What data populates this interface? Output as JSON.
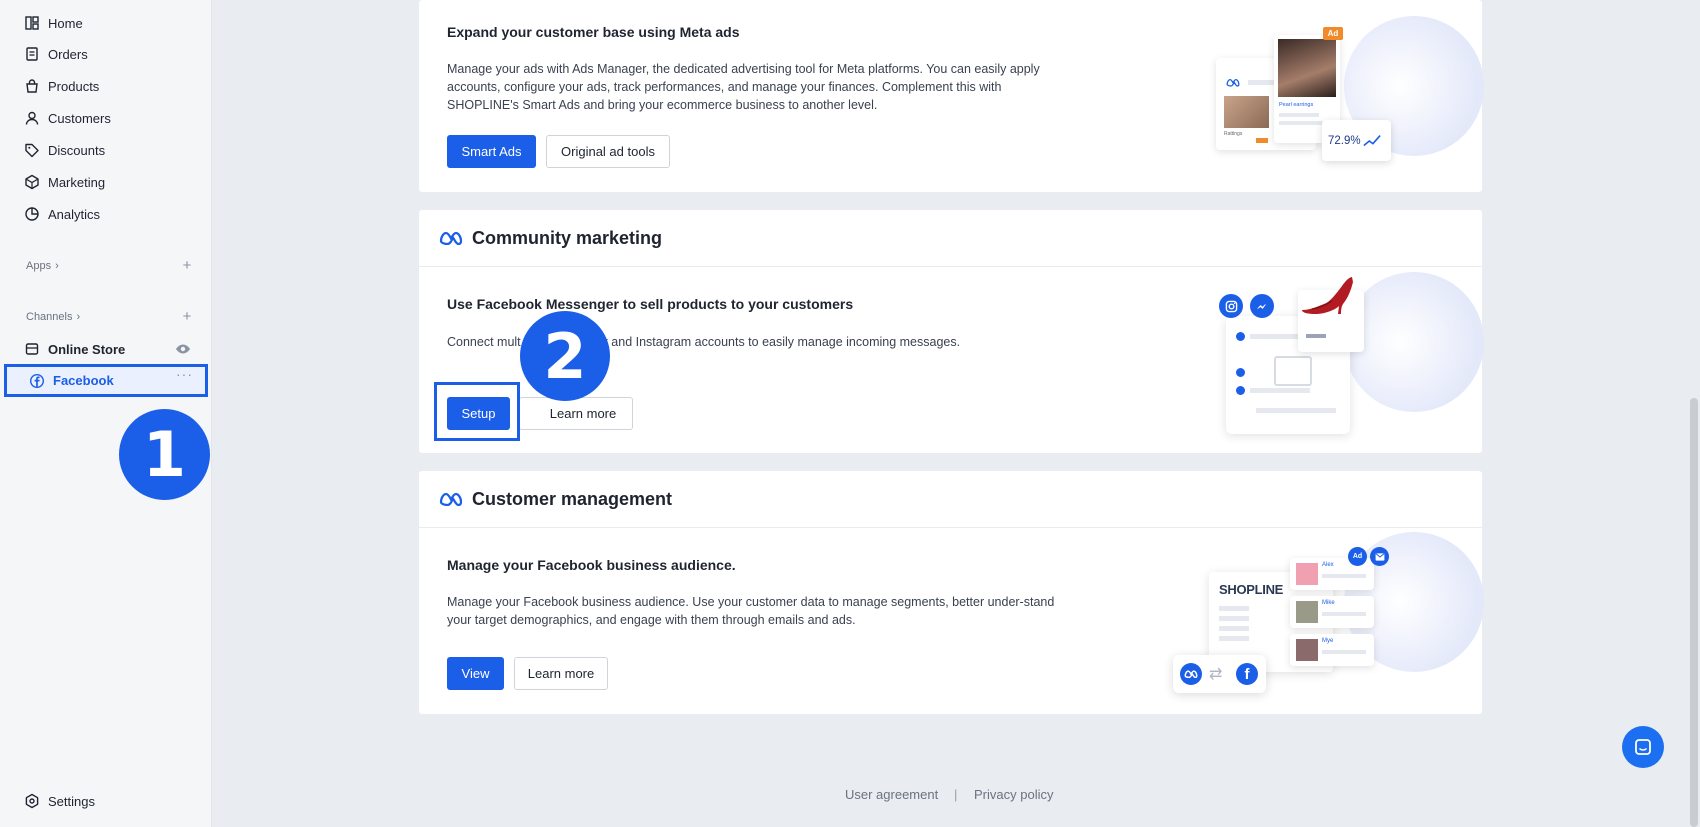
{
  "sidebar": {
    "items": [
      {
        "label": "Home",
        "icon": "home-icon"
      },
      {
        "label": "Orders",
        "icon": "orders-icon"
      },
      {
        "label": "Products",
        "icon": "products-icon"
      },
      {
        "label": "Customers",
        "icon": "customers-icon"
      },
      {
        "label": "Discounts",
        "icon": "discounts-icon"
      },
      {
        "label": "Marketing",
        "icon": "marketing-icon"
      },
      {
        "label": "Analytics",
        "icon": "analytics-icon"
      }
    ],
    "apps_label": "Apps",
    "channels_label": "Channels",
    "online_store_label": "Online Store",
    "facebook_label": "Facebook",
    "settings_label": "Settings"
  },
  "steps": {
    "one": "1",
    "two": "2"
  },
  "meta_ads": {
    "title": "Expand your customer base using Meta ads",
    "description": "Manage your ads with Ads Manager, the dedicated advertising tool for Meta platforms. You can easily apply accounts, configure your ads, track performances, and manage your finances. Complement this with SHOPLINE's Smart Ads and bring your ecommerce business to another level.",
    "primary_button": "Smart Ads",
    "secondary_button": "Original ad tools",
    "illus_badge": "Ad",
    "illus_stat": "72.9%",
    "illus_caption": "Pearl earrings",
    "illus_caption2": "Rattings"
  },
  "community": {
    "header": "Community marketing",
    "title": "Use Facebook Messenger to sell products to your customers",
    "description_start": "Connect mult",
    "description_end": "r and Instagram accounts to easily manage incoming messages.",
    "primary_button": "Setup",
    "secondary_button": "Learn more"
  },
  "customer_mgmt": {
    "header": "Customer management",
    "title": "Manage your Facebook business audience.",
    "description": "Manage your Facebook business audience. Use your customer data to manage segments, better under-stand your target demographics, and engage with them through emails and ads.",
    "primary_button": "View",
    "secondary_button": "Learn more",
    "illus_brand": "SHOPLINE",
    "illus_badge": "Ad",
    "illus_names": [
      "Alex",
      "Mike",
      "Mye"
    ]
  },
  "footer": {
    "user_agreement": "User agreement",
    "separator": "|",
    "privacy_policy": "Privacy policy"
  },
  "colors": {
    "accent": "#1b5ee8",
    "sidebar_bg": "#f4f6f8",
    "page_bg": "#e9ecf0"
  }
}
